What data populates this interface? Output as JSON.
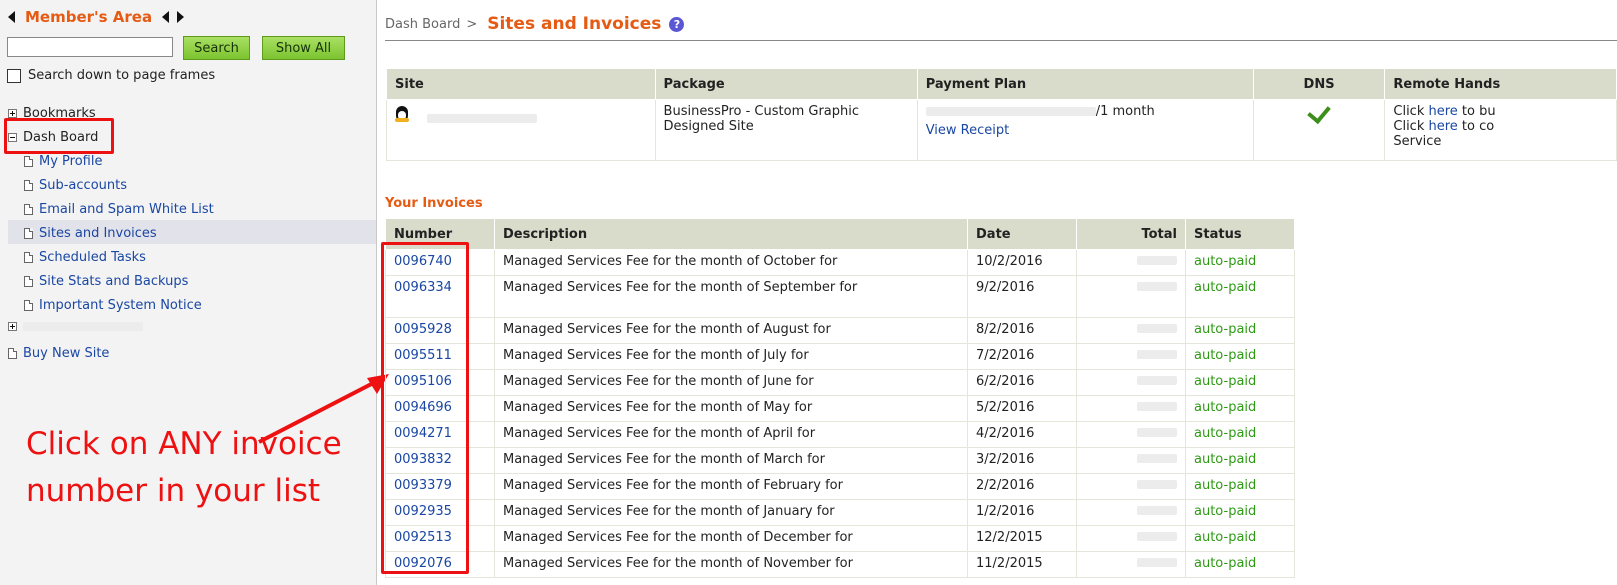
{
  "sidebar": {
    "title": "Member's Area",
    "search_placeholder": "",
    "search_button": "Search",
    "show_all_button": "Show All",
    "frames_checkbox_label": "Search down to page frames",
    "bookmarks_label": "Bookmarks",
    "dashboard_label": "Dash Board",
    "items": [
      {
        "label": "My Profile"
      },
      {
        "label": "Sub-accounts"
      },
      {
        "label": "Email and Spam White List"
      },
      {
        "label": "Sites and Invoices"
      },
      {
        "label": "Scheduled Tasks"
      },
      {
        "label": "Site Stats and Backups"
      },
      {
        "label": "Important System Notice"
      }
    ],
    "buy_new_site": "Buy New Site"
  },
  "annotation": {
    "text": "Click on ANY invoice number in your list"
  },
  "breadcrumb": {
    "parent": "Dash Board",
    "separator": ">",
    "current": "Sites and Invoices",
    "help": "?"
  },
  "sites_table": {
    "headers": [
      "Site",
      "Package",
      "Payment Plan",
      "DNS",
      "Remote Hands"
    ],
    "row": {
      "package": "BusinessPro - Custom Graphic Designed Site",
      "plan": "/1 month",
      "view_receipt": "View Receipt",
      "remote_line1_prefix": "Click ",
      "remote_line1_link": "here",
      "remote_line1_suffix": " to bu",
      "remote_line2_prefix": "Click ",
      "remote_line2_link": "here",
      "remote_line2_suffix": " to co",
      "remote_line3": "Service"
    }
  },
  "invoices": {
    "title": "Your Invoices",
    "headers": [
      "Number",
      "Description",
      "Date",
      "Total",
      "Status"
    ],
    "rows": [
      {
        "number": "0096740",
        "desc": "Managed Services Fee for the month of October for",
        "date": "10/2/2016",
        "status": "auto-paid"
      },
      {
        "number": "0096334",
        "desc": "Managed Services Fee for the month of September for",
        "date": "9/2/2016",
        "status": "auto-paid"
      },
      {
        "number": "0095928",
        "desc": "Managed Services Fee for the month of August for",
        "date": "8/2/2016",
        "status": "auto-paid"
      },
      {
        "number": "0095511",
        "desc": "Managed Services Fee for the month of July for",
        "date": "7/2/2016",
        "status": "auto-paid"
      },
      {
        "number": "0095106",
        "desc": "Managed Services Fee for the month of June for",
        "date": "6/2/2016",
        "status": "auto-paid"
      },
      {
        "number": "0094696",
        "desc": "Managed Services Fee for the month of May for",
        "date": "5/2/2016",
        "status": "auto-paid"
      },
      {
        "number": "0094271",
        "desc": "Managed Services Fee for the month of April for",
        "date": "4/2/2016",
        "status": "auto-paid"
      },
      {
        "number": "0093832",
        "desc": "Managed Services Fee for the month of March for",
        "date": "3/2/2016",
        "status": "auto-paid"
      },
      {
        "number": "0093379",
        "desc": "Managed Services Fee for the month of February for",
        "date": "2/2/2016",
        "status": "auto-paid"
      },
      {
        "number": "0092935",
        "desc": "Managed Services Fee for the month of January for",
        "date": "1/2/2016",
        "status": "auto-paid"
      },
      {
        "number": "0092513",
        "desc": "Managed Services Fee for the month of December for",
        "date": "12/2/2015",
        "status": "auto-paid"
      },
      {
        "number": "0092076",
        "desc": "Managed Services Fee for the month of November for",
        "date": "11/2/2015",
        "status": "auto-paid"
      }
    ]
  },
  "colors": {
    "accent_orange": "#e55b13",
    "link_blue": "#1a47a3",
    "paid_green": "#2e9a14",
    "annotation_red": "#ee1111",
    "header_bg": "#d9dccb"
  }
}
